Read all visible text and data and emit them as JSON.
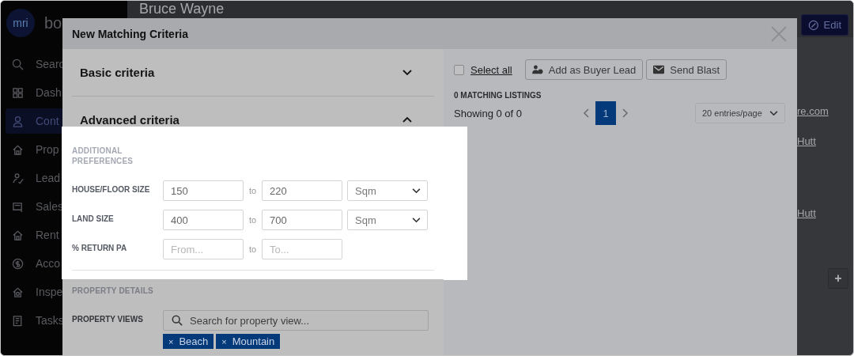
{
  "sidebar": {
    "logo": "mri",
    "brand": "bo",
    "items": [
      {
        "label": "Searc",
        "kind": "search",
        "selected": false
      },
      {
        "label": "Dash",
        "kind": "grid",
        "selected": false
      },
      {
        "label": "Cont",
        "kind": "person",
        "selected": true
      },
      {
        "label": "Prop",
        "kind": "house",
        "selected": false
      },
      {
        "label": "Lead",
        "kind": "lead",
        "selected": false
      },
      {
        "label": "Sales",
        "kind": "sign",
        "selected": false
      },
      {
        "label": "Rent",
        "kind": "house",
        "selected": false
      },
      {
        "label": "Acco",
        "kind": "dollar",
        "selected": false
      },
      {
        "label": "Inspe",
        "kind": "inspect",
        "selected": false
      },
      {
        "label": "Tasks",
        "kind": "tasks",
        "selected": false
      }
    ]
  },
  "page": {
    "title": "Bruce Wayne",
    "edit_button": "Edit",
    "links": [
      "re.com",
      "Hutt",
      "Hutt"
    ],
    "add_button": "+"
  },
  "modal": {
    "title": "New Matching Criteria",
    "sections": [
      {
        "title": "Basic criteria",
        "expanded": false
      },
      {
        "title": "Advanced criteria",
        "expanded": true
      }
    ],
    "additional": {
      "heading": "ADDITIONAL PREFERENCES",
      "spotlight": true,
      "rows": [
        {
          "label": "HOUSE/FLOOR SIZE",
          "from": {
            "value": "150"
          },
          "sep": "to",
          "to": {
            "value": "220"
          },
          "unit": "Sqm"
        },
        {
          "label": "LAND SIZE",
          "from": {
            "value": "400"
          },
          "sep": "to",
          "to": {
            "value": "700"
          },
          "unit": "Sqm"
        },
        {
          "label": "% RETURN PA",
          "from": {
            "placeholder": "From..."
          },
          "sep": "to",
          "to": {
            "placeholder": "To..."
          }
        }
      ]
    },
    "property_details": {
      "heading": "PROPERTY DETAILS",
      "views_label": "PROPERTY VIEWS",
      "search_placeholder": "Search for property view...",
      "tags": [
        {
          "remove": "×",
          "label": "Beach"
        },
        {
          "remove": "×",
          "label": "Mountain"
        }
      ]
    },
    "results": {
      "select_all": {
        "label": "Select all",
        "checked": false
      },
      "buttons": [
        {
          "label": "Add as Buyer Lead",
          "kind": "buyer"
        },
        {
          "label": "Send Blast",
          "kind": "mail"
        }
      ],
      "count": "0 MATCHING LISTINGS",
      "showing": "Showing 0 of 0",
      "pages": [
        {
          "label": "1",
          "selected": true
        }
      ],
      "per_page": "20 entries/page"
    }
  }
}
